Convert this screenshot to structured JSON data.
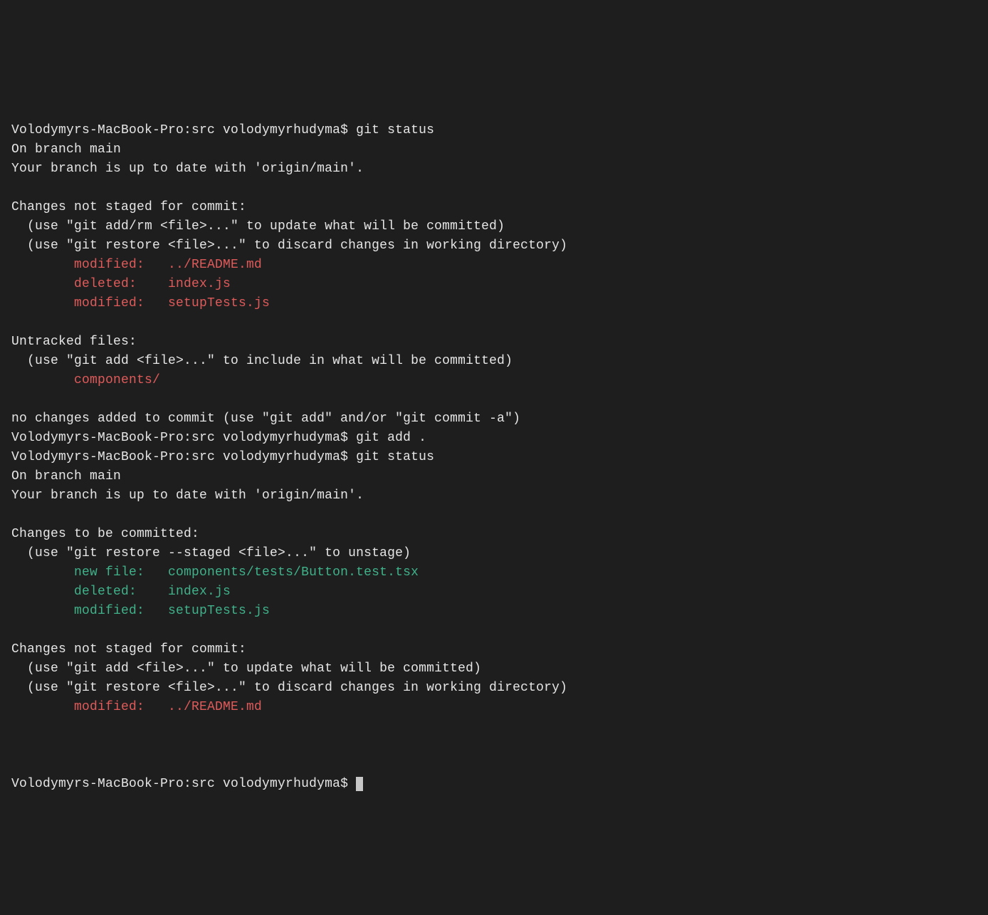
{
  "lines": [
    {
      "segments": [
        {
          "text": "Volodymyrs-MacBook-Pro:src volodymyrhudyma$ git status"
        }
      ]
    },
    {
      "segments": [
        {
          "text": "On branch main"
        }
      ]
    },
    {
      "segments": [
        {
          "text": "Your branch is up to date with 'origin/main'."
        }
      ]
    },
    {
      "segments": [
        {
          "text": ""
        }
      ]
    },
    {
      "segments": [
        {
          "text": "Changes not staged for commit:"
        }
      ]
    },
    {
      "segments": [
        {
          "text": "  (use \"git add/rm <file>...\" to update what will be committed)"
        }
      ]
    },
    {
      "segments": [
        {
          "text": "  (use \"git restore <file>...\" to discard changes in working directory)"
        }
      ]
    },
    {
      "segments": [
        {
          "text": "        "
        },
        {
          "text": "modified:   ../README.md",
          "class": "red"
        }
      ]
    },
    {
      "segments": [
        {
          "text": "        "
        },
        {
          "text": "deleted:    index.js",
          "class": "red"
        }
      ]
    },
    {
      "segments": [
        {
          "text": "        "
        },
        {
          "text": "modified:   setupTests.js",
          "class": "red"
        }
      ]
    },
    {
      "segments": [
        {
          "text": ""
        }
      ]
    },
    {
      "segments": [
        {
          "text": "Untracked files:"
        }
      ]
    },
    {
      "segments": [
        {
          "text": "  (use \"git add <file>...\" to include in what will be committed)"
        }
      ]
    },
    {
      "segments": [
        {
          "text": "        "
        },
        {
          "text": "components/",
          "class": "red"
        }
      ]
    },
    {
      "segments": [
        {
          "text": ""
        }
      ]
    },
    {
      "segments": [
        {
          "text": "no changes added to commit (use \"git add\" and/or \"git commit -a\")"
        }
      ]
    },
    {
      "segments": [
        {
          "text": "Volodymyrs-MacBook-Pro:src volodymyrhudyma$ git add ."
        }
      ]
    },
    {
      "segments": [
        {
          "text": "Volodymyrs-MacBook-Pro:src volodymyrhudyma$ git status"
        }
      ]
    },
    {
      "segments": [
        {
          "text": "On branch main"
        }
      ]
    },
    {
      "segments": [
        {
          "text": "Your branch is up to date with 'origin/main'."
        }
      ]
    },
    {
      "segments": [
        {
          "text": ""
        }
      ]
    },
    {
      "segments": [
        {
          "text": "Changes to be committed:"
        }
      ]
    },
    {
      "segments": [
        {
          "text": "  (use \"git restore --staged <file>...\" to unstage)"
        }
      ]
    },
    {
      "segments": [
        {
          "text": "        "
        },
        {
          "text": "new file:   components/tests/Button.test.tsx",
          "class": "green"
        }
      ]
    },
    {
      "segments": [
        {
          "text": "        "
        },
        {
          "text": "deleted:    index.js",
          "class": "green"
        }
      ]
    },
    {
      "segments": [
        {
          "text": "        "
        },
        {
          "text": "modified:   setupTests.js",
          "class": "green"
        }
      ]
    },
    {
      "segments": [
        {
          "text": ""
        }
      ]
    },
    {
      "segments": [
        {
          "text": "Changes not staged for commit:"
        }
      ]
    },
    {
      "segments": [
        {
          "text": "  (use \"git add <file>...\" to update what will be committed)"
        }
      ]
    },
    {
      "segments": [
        {
          "text": "  (use \"git restore <file>...\" to discard changes in working directory)"
        }
      ]
    },
    {
      "segments": [
        {
          "text": "        "
        },
        {
          "text": "modified:   ../README.md",
          "class": "red"
        }
      ]
    },
    {
      "segments": [
        {
          "text": ""
        }
      ]
    }
  ],
  "final_prompt": "Volodymyrs-MacBook-Pro:src volodymyrhudyma$ "
}
